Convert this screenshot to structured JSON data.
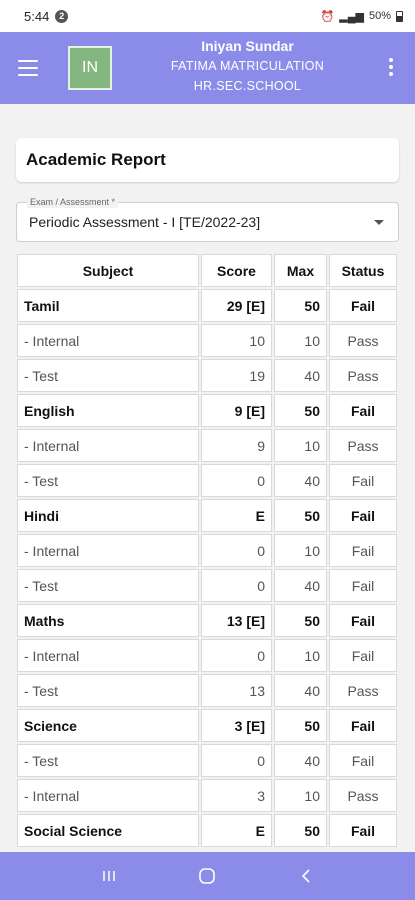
{
  "status_bar": {
    "time": "5:44",
    "badge": "2",
    "battery": "50%"
  },
  "header": {
    "avatar_initials": "IN",
    "student_name": "Iniyan Sundar",
    "school_line1": "FATIMA MATRICULATION",
    "school_line2": "HR.SEC.SCHOOL"
  },
  "page": {
    "title": "Academic Report"
  },
  "exam_select": {
    "label": "Exam / Assessment *",
    "value": "Periodic Assessment - I [TE/2022-23]"
  },
  "table": {
    "headers": [
      "Subject",
      "Score",
      "Max",
      "Status"
    ],
    "rows": [
      {
        "subject": "Tamil",
        "score": "29 [E]",
        "max": "50",
        "status": "Fail",
        "main": true
      },
      {
        "subject": "- Internal",
        "score": "10",
        "max": "10",
        "status": "Pass",
        "main": false
      },
      {
        "subject": "- Test",
        "score": "19",
        "max": "40",
        "status": "Pass",
        "main": false
      },
      {
        "subject": "English",
        "score": "9 [E]",
        "max": "50",
        "status": "Fail",
        "main": true
      },
      {
        "subject": "- Internal",
        "score": "9",
        "max": "10",
        "status": "Pass",
        "main": false
      },
      {
        "subject": "- Test",
        "score": "0",
        "max": "40",
        "status": "Fail",
        "main": false
      },
      {
        "subject": "Hindi",
        "score": "E",
        "max": "50",
        "status": "Fail",
        "main": true
      },
      {
        "subject": "- Internal",
        "score": "0",
        "max": "10",
        "status": "Fail",
        "main": false
      },
      {
        "subject": "- Test",
        "score": "0",
        "max": "40",
        "status": "Fail",
        "main": false
      },
      {
        "subject": "Maths",
        "score": "13 [E]",
        "max": "50",
        "status": "Fail",
        "main": true
      },
      {
        "subject": "- Internal",
        "score": "0",
        "max": "10",
        "status": "Fail",
        "main": false
      },
      {
        "subject": "- Test",
        "score": "13",
        "max": "40",
        "status": "Pass",
        "main": false
      },
      {
        "subject": "Science",
        "score": "3 [E]",
        "max": "50",
        "status": "Fail",
        "main": true
      },
      {
        "subject": "- Test",
        "score": "0",
        "max": "40",
        "status": "Fail",
        "main": false
      },
      {
        "subject": "- Internal",
        "score": "3",
        "max": "10",
        "status": "Pass",
        "main": false
      },
      {
        "subject": "Social Science",
        "score": "E",
        "max": "50",
        "status": "Fail",
        "main": true
      }
    ]
  },
  "colors": {
    "accent": "#8b8cea",
    "avatar_bg": "#84b77f"
  },
  "icons": {
    "menu": "menu-icon",
    "more": "more-vert-icon",
    "nav_recents": "recents-icon",
    "nav_home": "home-icon",
    "nav_back": "back-icon"
  }
}
